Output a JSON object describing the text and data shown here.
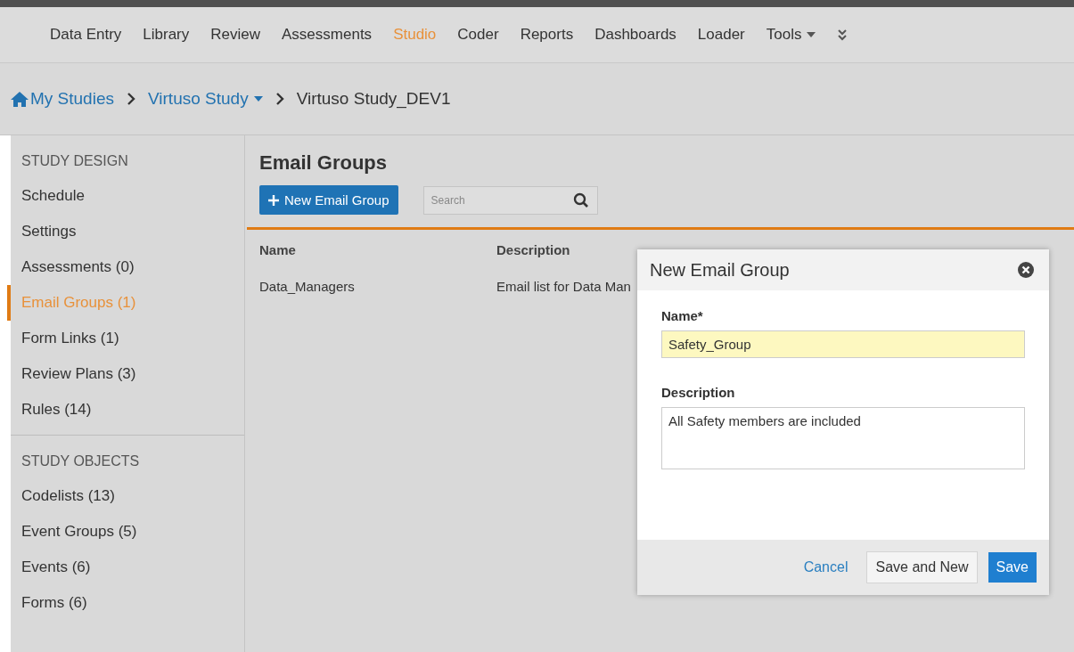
{
  "nav": {
    "items": [
      {
        "label": "Data Entry",
        "selected": false,
        "kind": "link"
      },
      {
        "label": "Library",
        "selected": false,
        "kind": "link"
      },
      {
        "label": "Review",
        "selected": false,
        "kind": "link"
      },
      {
        "label": "Assessments",
        "selected": false,
        "kind": "link"
      },
      {
        "label": "Studio",
        "selected": true,
        "kind": "link"
      },
      {
        "label": "Coder",
        "selected": false,
        "kind": "link"
      },
      {
        "label": "Reports",
        "selected": false,
        "kind": "link"
      },
      {
        "label": "Dashboards",
        "selected": false,
        "kind": "link"
      },
      {
        "label": "Loader",
        "selected": false,
        "kind": "link"
      },
      {
        "label": "Tools",
        "selected": false,
        "kind": "dropdown"
      }
    ]
  },
  "breadcrumb": [
    {
      "label": "My Studies",
      "kind": "home"
    },
    {
      "label": "Virtuso Study",
      "kind": "dropdown"
    },
    {
      "label": "Virtuso Study_DEV1",
      "kind": "current"
    }
  ],
  "sidebar": {
    "sections": [
      {
        "title": "STUDY DESIGN",
        "items": [
          {
            "label": "Schedule",
            "selected": false
          },
          {
            "label": "Settings",
            "selected": false
          },
          {
            "label": "Assessments (0)",
            "selected": false
          },
          {
            "label": "Email Groups (1)",
            "selected": true
          },
          {
            "label": "Form Links (1)",
            "selected": false
          },
          {
            "label": "Review Plans (3)",
            "selected": false
          },
          {
            "label": "Rules (14)",
            "selected": false
          }
        ]
      },
      {
        "title": "STUDY OBJECTS",
        "items": [
          {
            "label": "Codelists (13)",
            "selected": false
          },
          {
            "label": "Event Groups (5)",
            "selected": false
          },
          {
            "label": "Events (6)",
            "selected": false
          },
          {
            "label": "Forms (6)",
            "selected": false
          }
        ]
      }
    ]
  },
  "page": {
    "title": "Email Groups",
    "new_button": "New Email Group",
    "search": {
      "placeholder": "Search"
    }
  },
  "table": {
    "columns": [
      "Name",
      "Description"
    ],
    "rows": [
      [
        "Data_Managers",
        "Email list for Data Man"
      ]
    ]
  },
  "dialog": {
    "title": "New Email Group",
    "fields": [
      {
        "label": "Name*",
        "value": "Safety_Group",
        "kind": "text",
        "focused": true
      },
      {
        "label": "Description",
        "value": "All Safety members are included",
        "kind": "textarea",
        "focused": false
      }
    ],
    "buttons": [
      {
        "label": "Cancel",
        "kind": "link"
      },
      {
        "label": "Save and New",
        "kind": "secondary"
      },
      {
        "label": "Save",
        "kind": "primary"
      }
    ]
  }
}
